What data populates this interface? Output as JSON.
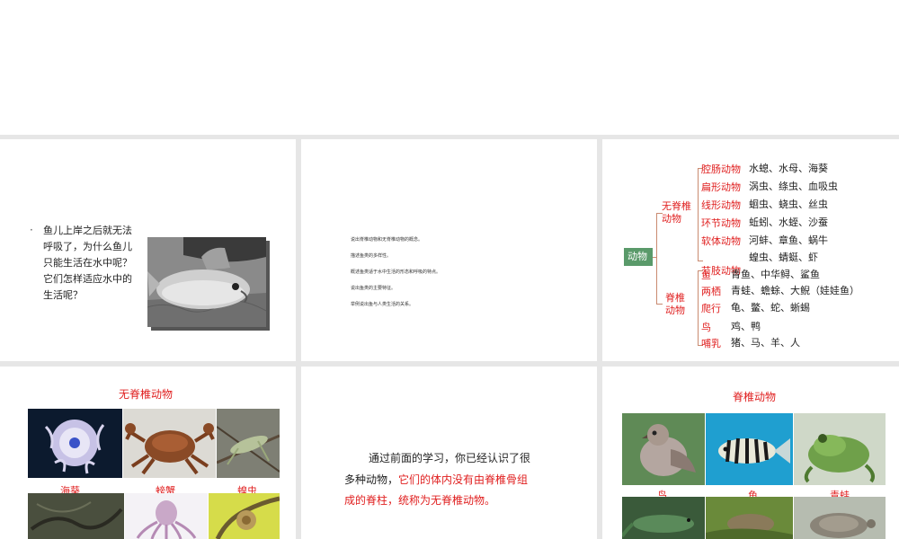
{
  "slide1": {
    "bullet": "·",
    "lines": [
      "鱼儿上岸之后就无法",
      "呼吸了，为什么鱼儿",
      "只能生活在水中呢？",
      "它们怎样适应水中的",
      "生活呢？"
    ]
  },
  "slide2": {
    "lines": [
      "说出脊椎动物和无脊椎动物的概念。",
      "描述鱼类的多样性。",
      "概述鱼类适于水中生活的形态和呼吸的特点。",
      "说出鱼类的主要特征。",
      "举例说出鱼与人类生活的关系。"
    ]
  },
  "slide3": {
    "root": "动物",
    "invert_group": "无脊椎\n动物",
    "vert_group": "脊椎\n动物",
    "invert": [
      {
        "cat": "腔肠动物",
        "ex": "水螅、水母、海葵"
      },
      {
        "cat": "扁形动物",
        "ex": "涡虫、绦虫、血吸虫"
      },
      {
        "cat": "线形动物",
        "ex": "蛔虫、蛲虫、丝虫"
      },
      {
        "cat": "环节动物",
        "ex": "蚯蚓、水蛭、沙蚕"
      },
      {
        "cat": "软体动物",
        "ex": "河蚌、章鱼、蜗牛"
      },
      {
        "cat": "节肢动物",
        "ex": "蝗虫、蜻蜓、虾"
      }
    ],
    "vert": [
      {
        "cat": "鱼",
        "ex": "青鱼、中华鲟、鲨鱼"
      },
      {
        "cat": "两栖",
        "ex": "青蛙、蟾蜍、大鲵（娃娃鱼）"
      },
      {
        "cat": "爬行",
        "ex": "龟、鳖、蛇、蜥蜴"
      },
      {
        "cat": "鸟",
        "ex": "鸡、鸭"
      },
      {
        "cat": "哺乳",
        "ex": "猪、马、羊、人"
      }
    ]
  },
  "slide4": {
    "title": "无脊椎动物",
    "captions": [
      "海葵",
      "螃蟹",
      "蝗虫"
    ]
  },
  "slide5": {
    "line1": "通过前面的学习，你已经认识了很",
    "line2a": "多种动物，",
    "line2b": "它们的体内没有由脊椎骨组",
    "line3": "成的脊柱，统称为无脊椎动物。"
  },
  "slide6": {
    "title": "脊椎动物",
    "captions": [
      "鸟",
      "鱼",
      "青蛙"
    ]
  },
  "colors": {
    "accent_red": "#e02020",
    "root_green": "#5a9a6a",
    "bracket": "#c98a70"
  }
}
